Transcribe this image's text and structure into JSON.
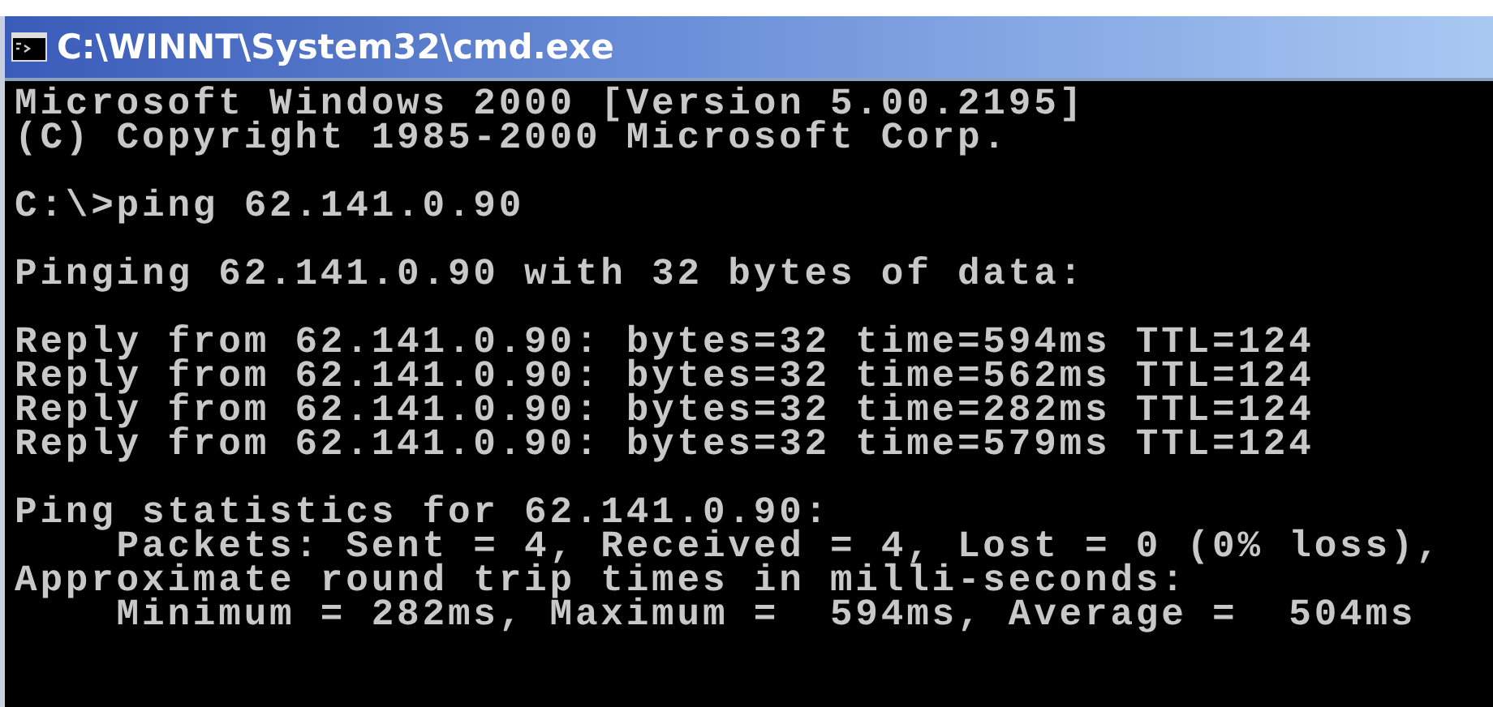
{
  "window": {
    "title": "C:\\WINNT\\System32\\cmd.exe"
  },
  "console": {
    "blocks": [
      [
        "Microsoft Windows 2000 [Version 5.00.2195]",
        "(C) Copyright 1985-2000 Microsoft Corp."
      ],
      [
        "C:\\>ping 62.141.0.90"
      ],
      [
        "Pinging 62.141.0.90 with 32 bytes of data:"
      ],
      [
        "Reply from 62.141.0.90: bytes=32 time=594ms TTL=124",
        "Reply from 62.141.0.90: bytes=32 time=562ms TTL=124",
        "Reply from 62.141.0.90: bytes=32 time=282ms TTL=124",
        "Reply from 62.141.0.90: bytes=32 time=579ms TTL=124"
      ],
      [
        "Ping statistics for 62.141.0.90:",
        "    Packets: Sent = 4, Received = 4, Lost = 0 (0% loss),",
        "Approximate round trip times in milli-seconds:",
        "    Minimum = 282ms, Maximum =  594ms, Average =  504ms"
      ]
    ]
  }
}
